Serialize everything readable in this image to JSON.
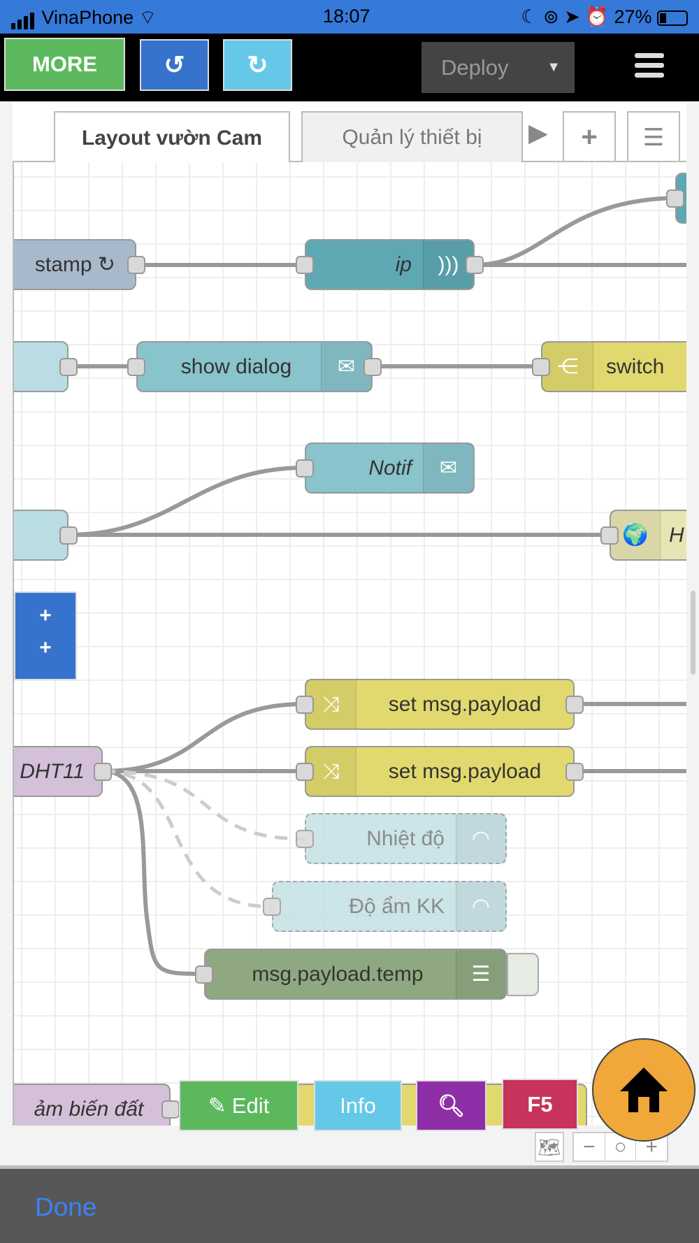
{
  "status_bar": {
    "carrier": "VinaPhone",
    "time": "18:07",
    "battery": "27%",
    "icons": [
      "signal-icon",
      "wifi-icon",
      "moon-icon",
      "rotation-lock-icon",
      "location-icon",
      "alarm-icon",
      "battery-icon"
    ]
  },
  "toolbar": {
    "more_label": "MORE",
    "undo_icon": "undo-icon",
    "redo_icon": "redo-icon",
    "deploy_label": "Deploy",
    "menu_icon": "hamburger-icon"
  },
  "tabs": [
    {
      "label": "Layout vườn Cam",
      "active": true
    },
    {
      "label": "Quản lý thiết bị",
      "active": false
    }
  ],
  "nodes": {
    "stamp": "stamp ↻",
    "ip": "ip",
    "show_dialog": "show dialog",
    "switch": "switch",
    "notif": "Notif",
    "http": "H",
    "dht11": "DHT11",
    "set1": "set msg.payload",
    "set2": "set msg.payload",
    "nhiet_do": "Nhiệt độ",
    "do_am": "Độ ẩm KK",
    "debug": "msg.payload.temp",
    "cam_bien": "ảm biến đất",
    "group_plus": [
      "+",
      "+"
    ]
  },
  "actions": {
    "edit": "Edit",
    "info": "Info",
    "search_icon": "search-icon",
    "f5": "F5",
    "home_icon": "home-icon"
  },
  "zoom_controls": {
    "minus": "−",
    "reset": "○",
    "plus": "+"
  },
  "done_label": "Done",
  "colors": {
    "status_bar": "#3579d9",
    "more": "#5cb85c",
    "undo": "#3573cc",
    "redo": "#66c8e8",
    "deploy": "#444444",
    "edit": "#5cb85c",
    "info": "#66c8e8",
    "search": "#8e2fa8",
    "f5": "#c8335b",
    "home": "#f0a83a",
    "done": "#3a82f7"
  }
}
